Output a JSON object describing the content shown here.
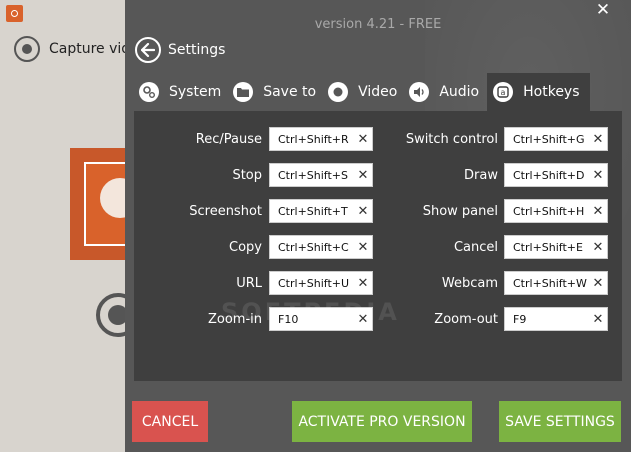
{
  "background_app": {
    "capture_label": "Capture vide"
  },
  "window": {
    "version": "version 4.21 - FREE",
    "close_glyph": "✕"
  },
  "header": {
    "title": "Settings",
    "back_icon": "arrow-left-icon"
  },
  "tabs": [
    {
      "label": "System",
      "icon": "gears-icon",
      "active": false
    },
    {
      "label": "Save to",
      "icon": "folder-icon",
      "active": false
    },
    {
      "label": "Video",
      "icon": "record-icon",
      "active": false
    },
    {
      "label": "Audio",
      "icon": "speaker-icon",
      "active": false
    },
    {
      "label": "Hotkeys",
      "icon": "keyboard-key-icon",
      "active": true
    }
  ],
  "hotkeys_left": [
    {
      "label": "Rec/Pause",
      "value": "Ctrl+Shift+R"
    },
    {
      "label": "Stop",
      "value": "Ctrl+Shift+S"
    },
    {
      "label": "Screenshot",
      "value": "Ctrl+Shift+T"
    },
    {
      "label": "Copy",
      "value": "Ctrl+Shift+C"
    },
    {
      "label": "URL",
      "value": "Ctrl+Shift+U"
    },
    {
      "label": "Zoom-in",
      "value": "F10"
    }
  ],
  "hotkeys_right": [
    {
      "label": "Switch control",
      "value": "Ctrl+Shift+G"
    },
    {
      "label": "Draw",
      "value": "Ctrl+Shift+D"
    },
    {
      "label": "Show panel",
      "value": "Ctrl+Shift+H"
    },
    {
      "label": "Cancel",
      "value": "Ctrl+Shift+E"
    },
    {
      "label": "Webcam",
      "value": "Ctrl+Shift+W"
    },
    {
      "label": "Zoom-out",
      "value": "F9"
    }
  ],
  "clear_glyph": "✕",
  "watermark": "SOFTPEDIA",
  "footer": {
    "cancel": "CANCEL",
    "activate": "ACTIVATE PRO VERSION",
    "save": "SAVE SETTINGS"
  },
  "colors": {
    "panel": "#575757",
    "content": "#3f3f3f",
    "cancel": "#d9534f",
    "green": "#7cb342",
    "accent": "#d9622b"
  }
}
